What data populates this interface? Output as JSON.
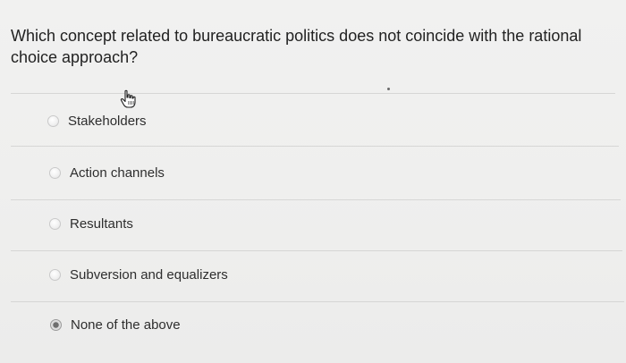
{
  "question": {
    "text": "Which concept related to bureaucratic politics does not coincide with the rational choice approach?"
  },
  "options": [
    {
      "label": "Stakeholders",
      "selected": false
    },
    {
      "label": "Action channels",
      "selected": false
    },
    {
      "label": "Resultants",
      "selected": false
    },
    {
      "label": "Subversion and equalizers",
      "selected": false
    },
    {
      "label": "None of the above",
      "selected": true
    }
  ],
  "cursor": {
    "icon": "hand-pointer-icon"
  }
}
